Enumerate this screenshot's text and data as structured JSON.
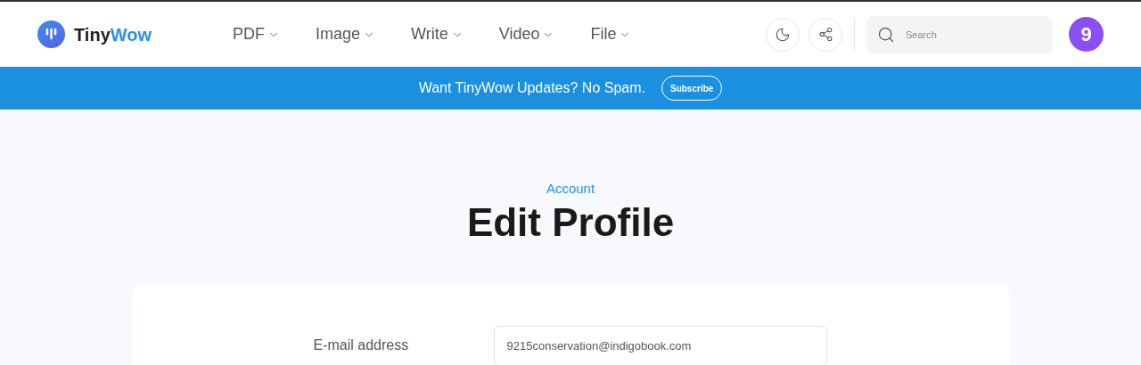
{
  "brand": {
    "first": "Tiny",
    "second": "Wow"
  },
  "nav": [
    {
      "label": "PDF"
    },
    {
      "label": "Image"
    },
    {
      "label": "Write"
    },
    {
      "label": "Video"
    },
    {
      "label": "File"
    }
  ],
  "search": {
    "placeholder": "Search"
  },
  "avatar": {
    "initial": "9"
  },
  "banner": {
    "text": "Want TinyWow Updates? No Spam.",
    "button": "Subscribe"
  },
  "page": {
    "eyebrow": "Account",
    "title": "Edit Profile"
  },
  "form": {
    "fields": [
      {
        "label": "E-mail address",
        "value": "9215conservation@indigobook.com"
      }
    ]
  }
}
